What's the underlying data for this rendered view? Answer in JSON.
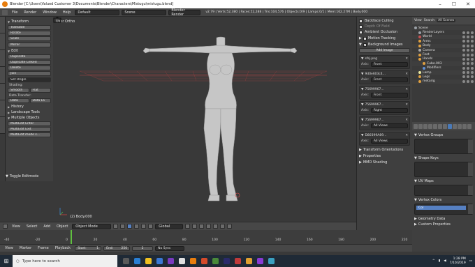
{
  "window": {
    "title": "Blender [C:\\Users\\Valued Customer 3\\Documents\\Blender\\Characters\\Mistugu\\mistugu.blend]",
    "minimize": "–",
    "maximize": "☐",
    "close": "✕"
  },
  "info_header": {
    "menus": [
      "File",
      "Render",
      "Window",
      "Help"
    ],
    "layout": "Default",
    "scene": "Scene",
    "engine": "Blender Render",
    "stats": "v2.79 | Verts:52,380 | Faces:52,288 | Tris:104,576 | Objects:0/9 | Lamps:0/1 | Mem:162.27M | Body.000"
  },
  "tool_shelf": {
    "transform_header": "Transform",
    "transform_buttons": [
      "Translate",
      "Rotate",
      "Scale",
      "Mirror"
    ],
    "edit_header": "Edit",
    "edit_buttons": [
      "Duplicate",
      "Duplicate Linked",
      "Delete",
      "Join"
    ],
    "set_origin": "Set Origin",
    "shading_label": "Shading:",
    "shading_smooth": "Smooth",
    "shading_flat": "Flat",
    "data_transfer_label": "Data Transfer:",
    "data_btn": "Data",
    "data_layout_btn": "Data La",
    "history_header": "History",
    "landscape_header": "Landscape Tools",
    "multiple_objects_header": "Multiple Objects",
    "multiedit_buttons": [
      "MultiEdit Enter",
      "MultiEdit Exit",
      "MultiEdit mode s..."
    ],
    "toggle_editmode": "Toggle Editmode"
  },
  "viewport": {
    "view_label": "User Ortho",
    "object_label": "(2) Body.000"
  },
  "viewport_header": {
    "menus": [
      "View",
      "Select",
      "Add",
      "Object"
    ],
    "mode": "Object Mode",
    "orientation": "Global"
  },
  "npanel": {
    "checks": [
      {
        "label": "Backface Culling",
        "on": false,
        "dim": false
      },
      {
        "label": "Depth Of Field",
        "on": false,
        "dim": true
      },
      {
        "label": "Ambient Occlusion",
        "on": false,
        "dim": false
      }
    ],
    "motion_tracking": "Motion Tracking",
    "background_images": "Background Images",
    "add_image": "Add Image",
    "axis_label": "Axis:",
    "images": [
      {
        "name": "sfsj.png",
        "axis": "Front"
      },
      {
        "name": "9d0e603c4...",
        "axis": "Front"
      },
      {
        "name": "75699967...",
        "axis": "Front"
      },
      {
        "name": "75699967...",
        "axis": "Right"
      },
      {
        "name": "75699967...",
        "axis": "All Views"
      },
      {
        "name": "D80399A89...",
        "axis": "All Views"
      }
    ],
    "transform_orientations": "Transform Orientations",
    "properties": "Properties",
    "mmd_shading": "MMD Shading"
  },
  "outliner": {
    "tabs": [
      "View",
      "Search",
      "All Scenes"
    ],
    "rows": [
      {
        "label": "Scene",
        "indent": 0,
        "color": "#9aa0a6"
      },
      {
        "label": "RenderLayers",
        "indent": 1,
        "color": "#9aa0a6"
      },
      {
        "label": "World",
        "indent": 1,
        "color": "#c75050"
      },
      {
        "label": "Arms",
        "indent": 1,
        "color": "#e0a040"
      },
      {
        "label": "Body",
        "indent": 1,
        "color": "#e0a040"
      },
      {
        "label": "Camera",
        "indent": 1,
        "color": "#aaaaaa"
      },
      {
        "label": "Feet",
        "indent": 1,
        "color": "#e0a040"
      },
      {
        "label": "Hands",
        "indent": 1,
        "color": "#e0a040"
      },
      {
        "label": "Cube.003",
        "indent": 2,
        "color": "#e0a040"
      },
      {
        "label": "Modifiers",
        "indent": 2,
        "color": "#5f8fd4"
      },
      {
        "label": "Lamp",
        "indent": 1,
        "color": "#e8e8a0"
      },
      {
        "label": "Legs",
        "indent": 1,
        "color": "#e0a040"
      },
      {
        "label": "metarig",
        "indent": 1,
        "color": "#e0a040"
      }
    ]
  },
  "properties": {
    "vertex_groups": "Vertex Groups",
    "shape_keys": "Shape Keys",
    "uv_maps": "UV Maps",
    "vertex_colors": "Vertex Colors",
    "vertex_color_item": "Col",
    "geometry_data": "Geometry Data",
    "custom_properties": "Custom Properties"
  },
  "timeline": {
    "ticks": [
      "-40",
      "-20",
      "0",
      "20",
      "40",
      "60",
      "80",
      "100",
      "120",
      "140",
      "160",
      "180",
      "200",
      "220",
      "240",
      "260"
    ],
    "current_frame": 1
  },
  "timeline_header": {
    "menus": [
      "View",
      "Marker",
      "Frame",
      "Playback"
    ],
    "start_label": "Start:",
    "start_value": "1",
    "end_label": "End:",
    "end_value": "250",
    "current": "2",
    "sync": "No Sync"
  },
  "taskbar": {
    "search_placeholder": "Type here to search",
    "time": "1:28 PM",
    "date": "7/10/2019"
  },
  "colors": {
    "accent": "#5680c2",
    "timeline_cursor": "#60c040",
    "taskbar": "#1f2a36"
  }
}
